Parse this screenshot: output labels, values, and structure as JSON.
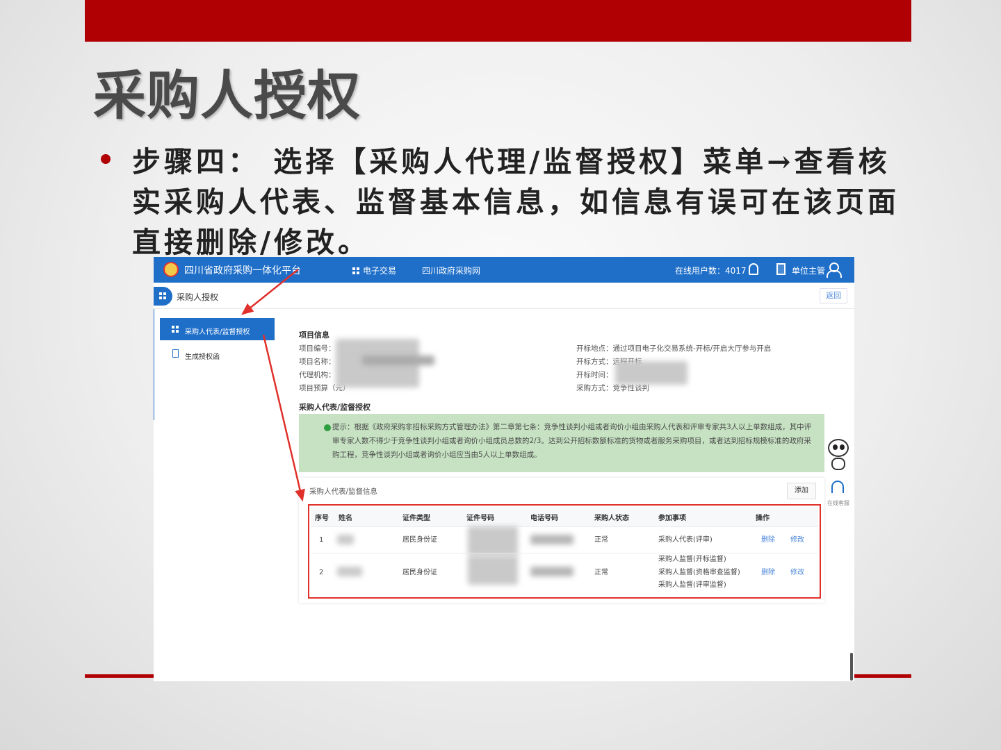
{
  "slide": {
    "title": "采购人授权",
    "bullet": "步骤四： 选择【采购人代理/监督授权】菜单→查看核实采购人代表、监督基本信息，如信息有误可在该页面直接删除/修改。"
  },
  "app": {
    "site_name": "四川省政府采购一体化平台",
    "nav": [
      "电子交易",
      "四川政府采购网"
    ],
    "online_users": "在线用户数：4017",
    "unit_label": "单位主管",
    "page_title": "采购人授权",
    "back_label": "返回"
  },
  "sidebar": {
    "items": [
      {
        "label": "采购人代表/监督授权",
        "active": true
      },
      {
        "label": "生成授权函",
        "active": false
      }
    ]
  },
  "project_info": {
    "heading": "项目信息",
    "left": [
      "项目编号：",
      "项目名称：",
      "代理机构：",
      "项目预算（元）"
    ],
    "right": [
      "开标地点：通过项目电子化交易系统-开标/开启大厅参与开启",
      "开标方式：远程开标",
      "开标时间：",
      "采购方式：竞争性谈判"
    ]
  },
  "auth_section": {
    "heading": "采购人代表/监督授权",
    "notice": "提示：根据《政府采购非招标采购方式管理办法》第二章第七条：竞争性谈判小组或者询价小组由采购人代表和评审专家共3人以上单数组成，其中评审专家人数不得少于竞争性谈判小组或者询价小组成员总数的2/3。达到公开招标数额标准的货物或者服务采购项目，或者达到招标规模标准的政府采购工程，竞争性谈判小组或者询价小组应当由5人以上单数组成。",
    "list_title": "采购人代表/监督信息",
    "add_label": "添加"
  },
  "table": {
    "headers": [
      "序号",
      "姓名",
      "证件类型",
      "证件号码",
      "电话号码",
      "采购人状态",
      "参加事项",
      "操作"
    ],
    "rows": [
      {
        "no": "1",
        "id_type": "居民身份证",
        "status": "正常",
        "items": [
          "采购人代表(评审)"
        ],
        "delete": "删除",
        "edit": "修改"
      },
      {
        "no": "2",
        "id_type": "居民身份证",
        "status": "正常",
        "items": [
          "采购人监督(开标监督)",
          "采购人监督(资格审查监督)",
          "采购人监督(评审监督)"
        ],
        "delete": "删除",
        "edit": "修改"
      }
    ]
  },
  "widget": {
    "cs_label": "在线客服"
  },
  "colors": {
    "brand_red": "#b00003",
    "app_blue": "#1f6fc9",
    "notice_green": "#c6e2c2",
    "highlight_red": "#e0302b"
  }
}
